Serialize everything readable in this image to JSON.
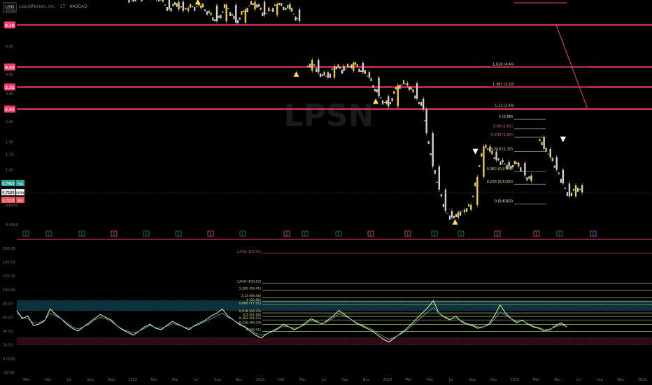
{
  "toolbar": {
    "currency": "USD",
    "symbol_name": "LiquidPerson, Inc.",
    "interval": "1T",
    "exchange": "NASDAQ"
  },
  "colors": {
    "background": "#000000",
    "level_line": "#ff3b6b",
    "candle_up": "#f2c94c",
    "candle_down": "#d1d1d1",
    "fib_text": "#f2c94c",
    "indicator_line": "#d6f07a",
    "indicator_ma": "#ff4d6d",
    "zone_top": "#0d3b4a",
    "zone_bottom": "#3a0d18",
    "ask": "#26a69a",
    "bid": "#ef5350",
    "event_badge": "#2e8b57",
    "event_badge_earnings": "#e35d6a",
    "event_badge_future": "#b05ad6"
  },
  "chart_data": [
    {
      "type": "line",
      "title": "",
      "scale": "log",
      "y_ticks": [
        "10.00",
        "8.00",
        "6.00",
        "4.00",
        "3.00",
        "2.00",
        "1.50",
        "1.25",
        "1.00",
        "0.7500",
        "0.6000",
        "0.4500"
      ],
      "price_levels": [
        {
          "label": "8,16",
          "value": 8.16
        },
        {
          "label": "4,43",
          "value": 4.43
        },
        {
          "label": "3,31",
          "value": 3.31
        },
        {
          "label": "2,41",
          "value": 2.41
        }
      ],
      "fib_levels": [
        {
          "label": "1,618 (4,44)",
          "value": 4.44
        },
        {
          "label": "1,382 (3,32)",
          "value": 3.32
        },
        {
          "label": "1,13 (2,44)",
          "value": 2.44
        },
        {
          "label": "1 (2,08)",
          "value": 2.08
        },
        {
          "label": "0,88 (1,81)",
          "value": 1.81
        },
        {
          "label": "0,786 (1,60)",
          "value": 1.6
        },
        {
          "label": "0,618 (1,30)",
          "value": 1.3
        },
        {
          "label": "0,382 (0,9749)",
          "value": 0.9749
        },
        {
          "label": "0,236 (0,8100)",
          "value": 0.81
        },
        {
          "label": "0 (0,6102)",
          "value": 0.6102
        }
      ],
      "price_tags": [
        {
          "label": "0,7400",
          "tag": "Ask"
        },
        {
          "label": "0,7185",
          "tag": "LPSN"
        },
        {
          "label": "0,7118",
          "tag": "Bid"
        }
      ],
      "watermark": "LPSN",
      "event_badges": [
        "E",
        "E",
        "E",
        "E",
        "E",
        "E",
        "E",
        "E",
        "E",
        "E",
        "E",
        "E",
        "E",
        "E",
        "E",
        "E",
        "E",
        "E",
        "E",
        "E",
        "E",
        "E"
      ],
      "candles": [
        {
          "t": 0.0,
          "close": 18.0
        },
        {
          "t": 0.06,
          "close": 17.0
        },
        {
          "t": 0.18,
          "close": 11.8
        },
        {
          "t": 0.22,
          "close": 12.6
        },
        {
          "t": 0.24,
          "close": 10.2
        },
        {
          "t": 0.255,
          "close": 11.4
        },
        {
          "t": 0.262,
          "close": 10.0
        },
        {
          "t": 0.27,
          "close": 10.4
        },
        {
          "t": 0.29,
          "close": 10.8
        },
        {
          "t": 0.315,
          "close": 8.6
        },
        {
          "t": 0.33,
          "close": 10.9
        },
        {
          "t": 0.345,
          "close": 8.4
        },
        {
          "t": 0.36,
          "close": 10.2
        },
        {
          "t": 0.375,
          "close": 11.4
        },
        {
          "t": 0.39,
          "close": 9.4
        },
        {
          "t": 0.41,
          "close": 11.0
        },
        {
          "t": 0.43,
          "close": 10.2
        },
        {
          "t": 0.445,
          "close": 8.6
        },
        {
          "t": 0.455,
          "close": 4.2
        },
        {
          "t": 0.465,
          "close": 4.9
        },
        {
          "t": 0.475,
          "close": 4.1
        },
        {
          "t": 0.49,
          "close": 3.8
        },
        {
          "t": 0.5,
          "close": 4.5
        },
        {
          "t": 0.515,
          "close": 4.2
        },
        {
          "t": 0.53,
          "close": 4.7
        },
        {
          "t": 0.545,
          "close": 4.1
        },
        {
          "t": 0.555,
          "close": 3.8
        },
        {
          "t": 0.57,
          "close": 2.9
        },
        {
          "t": 0.585,
          "close": 2.5
        },
        {
          "t": 0.6,
          "close": 3.4
        },
        {
          "t": 0.615,
          "close": 3.5
        },
        {
          "t": 0.63,
          "close": 2.8
        },
        {
          "t": 0.64,
          "close": 2.4
        },
        {
          "t": 0.645,
          "close": 1.7
        },
        {
          "t": 0.655,
          "close": 1.05
        },
        {
          "t": 0.665,
          "close": 0.75
        },
        {
          "t": 0.675,
          "close": 0.55
        },
        {
          "t": 0.685,
          "close": 0.5
        },
        {
          "t": 0.695,
          "close": 0.54
        },
        {
          "t": 0.705,
          "close": 0.56
        },
        {
          "t": 0.715,
          "close": 0.6
        },
        {
          "t": 0.725,
          "close": 0.9
        },
        {
          "t": 0.735,
          "close": 1.4
        },
        {
          "t": 0.745,
          "close": 1.3
        },
        {
          "t": 0.755,
          "close": 1.15
        },
        {
          "t": 0.765,
          "close": 1.12
        },
        {
          "t": 0.775,
          "close": 1.05
        },
        {
          "t": 0.79,
          "close": 1.1
        },
        {
          "t": 0.8,
          "close": 0.92
        },
        {
          "t": 0.81,
          "close": 0.85
        },
        {
          "t": 0.82,
          "close": 1.6
        },
        {
          "t": 0.83,
          "close": 1.35
        },
        {
          "t": 0.84,
          "close": 1.2
        },
        {
          "t": 0.85,
          "close": 1.0
        },
        {
          "t": 0.86,
          "close": 0.82
        },
        {
          "t": 0.87,
          "close": 0.68
        },
        {
          "t": 0.88,
          "close": 0.8
        },
        {
          "t": 0.89,
          "close": 0.72
        }
      ]
    },
    {
      "type": "line",
      "title": "",
      "y_ticks": [
        "160.00",
        "140.00",
        "120.00",
        "100.00",
        "80.00",
        "60.00",
        "40.00",
        "20.00",
        "0.0000",
        "-20.00"
      ],
      "ylim": [
        -20,
        170
      ],
      "fib_levels": [
        {
          "label": "2,618 (152,95)",
          "value": 152.95
        },
        {
          "label": "1,618 (109,63)",
          "value": 109.63
        },
        {
          "label": "1,382 (99,41)",
          "value": 99.41
        },
        {
          "label": "1,13 (88,48)",
          "value": 88.48
        },
        {
          "label": "1 (82,86)",
          "value": 82.86
        },
        {
          "label": "0,886 (77,91)",
          "value": 77.91
        },
        {
          "label": "0,618 (66,29)",
          "value": 66.29
        },
        {
          "label": "0,5 (61,18)",
          "value": 61.18
        },
        {
          "label": "0,382 (56,07)",
          "value": 56.07
        },
        {
          "label": "0,236 (49,74)",
          "value": 49.74
        },
        {
          "label": "0 (39,51)",
          "value": 39.51
        }
      ],
      "zones": [
        {
          "from": 70,
          "to": 84,
          "color": "#0d3b4a"
        },
        {
          "from": 20,
          "to": 30,
          "color": "#3a0d18"
        }
      ],
      "series": [
        {
          "values": [
            70,
            58,
            62,
            48,
            50,
            55,
            72,
            64,
            58,
            50,
            44,
            40,
            46,
            52,
            58,
            64,
            60,
            56,
            48,
            42,
            38,
            34,
            40,
            46,
            50,
            44,
            42,
            48,
            54,
            50,
            46,
            42,
            48,
            52,
            56,
            62,
            66,
            72,
            62,
            56,
            50,
            46,
            40,
            34,
            30,
            36,
            40,
            44,
            50,
            46,
            42,
            46,
            52,
            58,
            54,
            50,
            56,
            62,
            70,
            64,
            58,
            52,
            48,
            44,
            40,
            34,
            28,
            24,
            30,
            36,
            42,
            50,
            58,
            66,
            74,
            84,
            66,
            60,
            56,
            62,
            54,
            50,
            48,
            44,
            46,
            50,
            62,
            78,
            66,
            58,
            52,
            56,
            50,
            46,
            44,
            40,
            42,
            48,
            52,
            46
          ]
        },
        {
          "values": [
            66,
            60,
            58,
            52,
            52,
            56,
            66,
            62,
            58,
            52,
            46,
            43,
            46,
            50,
            56,
            60,
            58,
            54,
            48,
            43,
            40,
            37,
            40,
            44,
            48,
            45,
            44,
            47,
            51,
            49,
            46,
            44,
            47,
            50,
            54,
            58,
            62,
            66,
            60,
            56,
            51,
            47,
            42,
            37,
            34,
            36,
            39,
            43,
            47,
            46,
            44,
            46,
            50,
            55,
            53,
            51,
            54,
            59,
            65,
            62,
            58,
            53,
            49,
            46,
            42,
            37,
            32,
            28,
            31,
            35,
            40,
            47,
            54,
            61,
            68,
            74,
            66,
            61,
            58,
            59,
            55,
            51,
            49,
            46,
            46,
            49,
            57,
            68,
            63,
            58,
            54,
            55,
            51,
            47,
            45,
            42,
            43,
            46,
            49,
            47
          ]
        }
      ]
    }
  ],
  "x_axis": {
    "ticks": [
      "Mär",
      "Mai",
      "Jul",
      "Sep",
      "Nov",
      "2022",
      "Mär",
      "Mai",
      "Jul",
      "Sep",
      "Nov",
      "2023",
      "Mär",
      "Mai",
      "Jul",
      "Sep",
      "Nov",
      "2024",
      "Mär",
      "Mai",
      "Jul",
      "Sep",
      "Nov",
      "2025",
      "Mär",
      "Mai",
      "Jul",
      "Sep",
      "Nov",
      "2026"
    ]
  }
}
